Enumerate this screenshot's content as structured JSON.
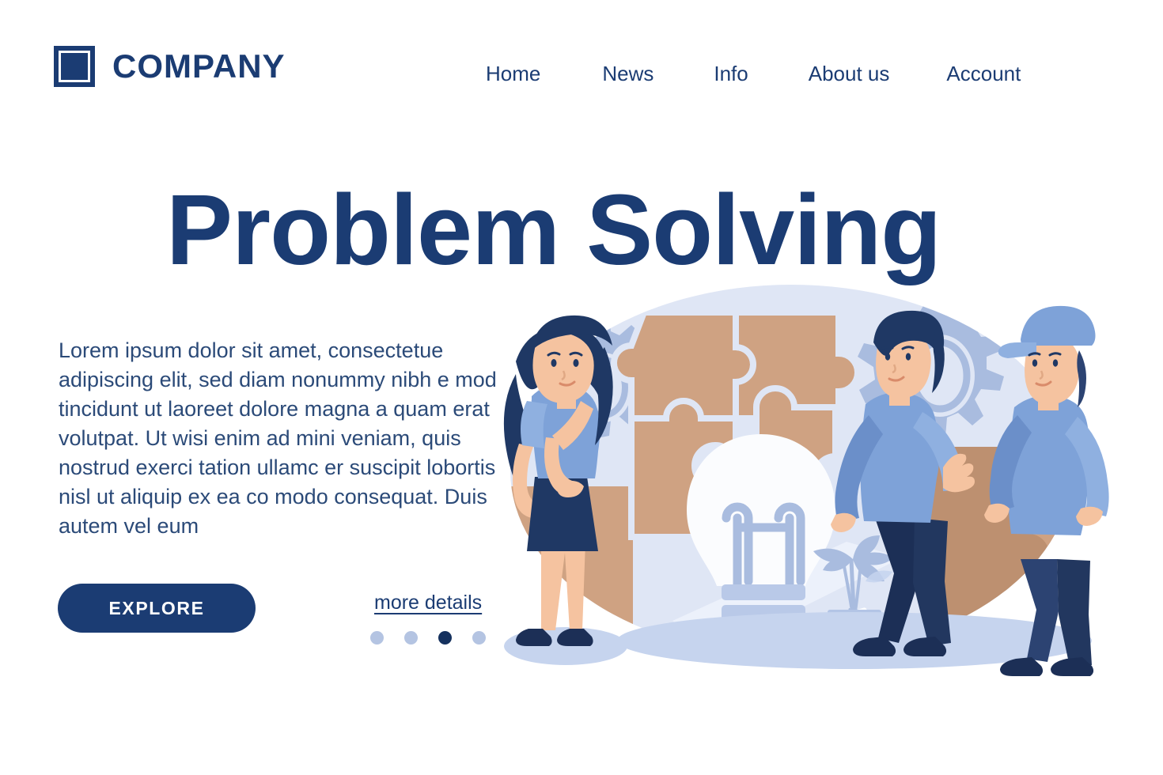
{
  "header": {
    "logo_icon": "square-logo-icon",
    "brand_name": "COMPANY",
    "nav": [
      {
        "label": "Home"
      },
      {
        "label": "News"
      },
      {
        "label": "Info"
      },
      {
        "label": "About us"
      },
      {
        "label": "Account"
      }
    ]
  },
  "hero": {
    "headline": "Problem Solving",
    "body": "Lorem ipsum dolor sit amet, consectetue adipiscing elit, sed diam nonummy nibh e mod tincidunt ut laoreet dolore magna a quam erat volutpat. Ut wisi enim ad mini veniam, quis nostrud exerci tation ullamc er suscipit lobortis nisl ut aliquip ex ea co modo consequat. Duis autem vel eum",
    "explore_label": "EXPLORE",
    "more_details_label": "more details",
    "carousel": {
      "total": 4,
      "active_index": 2
    }
  },
  "illustration": {
    "name": "problem-solving-teamwork-illustration",
    "elements": [
      "background-ellipse",
      "gear-icon-large",
      "gear-icon-medium",
      "gear-icon-small",
      "puzzle-piece-group",
      "lightbulb-icon",
      "potted-plant-icon",
      "woman-character",
      "man-character",
      "man-with-cap-character",
      "floor-shadow-ellipse"
    ]
  },
  "colors": {
    "brand_navy": "#1b3c73",
    "text_navy": "#2b4a78",
    "dot_inactive": "#b4c4e2",
    "dot_active": "#15315e",
    "puzzle_tan": "#cfa282",
    "puzzle_tan_dark": "#bd9070",
    "backdrop_blue": "#dfe6f5",
    "gear_blue": "#a9bcdf",
    "shirt_blue": "#7ea2d8",
    "shirt_blue_dark": "#6b8fc9",
    "hair_navy": "#1f3864",
    "skin": "#f5c3a0",
    "bulb_white": "#fbfcfe",
    "floor_blue": "#c6d4ee"
  }
}
